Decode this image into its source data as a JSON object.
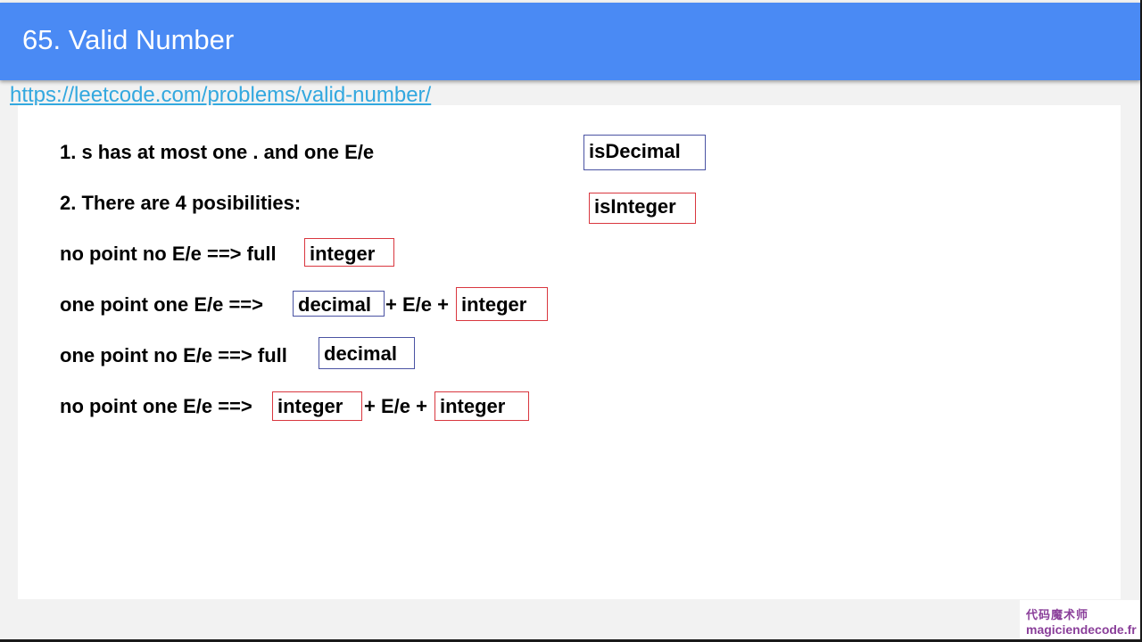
{
  "header": {
    "title": "65. Valid Number"
  },
  "link": {
    "text": "https://leetcode.com/problems/valid-number/"
  },
  "lines": [
    "1. s has at most one . and one E/e",
    "2. There are 4 posibilities:",
    "no point no E/e ==> full",
    "one point one E/e ==>",
    "+ E/e +",
    "one point no E/e ==> full",
    "no point one E/e ==>",
    "+ E/e +"
  ],
  "boxes": {
    "is_decimal": "isDecimal",
    "is_integer": "isInteger",
    "integer": "integer",
    "decimal": "decimal"
  },
  "watermark": {
    "chinese": "代码魔术师",
    "site": "magiciendecode.fr"
  },
  "colors": {
    "header": "#4a8af4",
    "link": "#33a8df",
    "decimal_box": "#4a53a3",
    "integer_box": "#d9373f",
    "watermark": "#8a3f9a"
  }
}
